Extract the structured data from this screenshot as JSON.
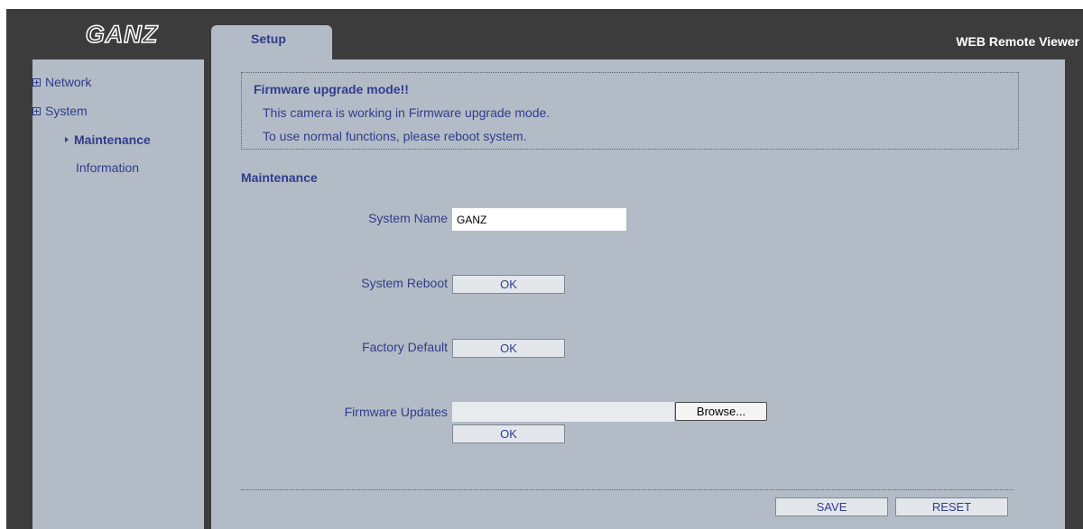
{
  "header": {
    "logo_text": "GANZ",
    "app_title": "WEB Remote Viewer",
    "tabs": [
      {
        "label": "Setup",
        "active": true
      }
    ]
  },
  "sidebar": {
    "items": [
      {
        "label": "Network",
        "type": "group"
      },
      {
        "label": "System",
        "type": "group"
      },
      {
        "label": "Maintenance",
        "type": "subitem",
        "active": true
      },
      {
        "label": "Information",
        "type": "subitem"
      }
    ]
  },
  "notice": {
    "title": "Firmware upgrade mode!!",
    "line1": "This camera is working in Firmware upgrade mode.",
    "line2": "To use normal functions, please reboot system."
  },
  "maintenance": {
    "section_title": "Maintenance",
    "system_name": {
      "label": "System Name",
      "value": "GANZ"
    },
    "system_reboot": {
      "label": "System Reboot",
      "button": "OK"
    },
    "factory_default": {
      "label": "Factory Default",
      "button": "OK"
    },
    "firmware_updates": {
      "label": "Firmware Updates",
      "browse": "Browse...",
      "button": "OK",
      "file_value": ""
    }
  },
  "footer": {
    "save": "SAVE",
    "reset": "RESET"
  },
  "colors": {
    "frame": "#3c3c3c",
    "panel": "#b3bcc6",
    "text": "#303c8c"
  }
}
